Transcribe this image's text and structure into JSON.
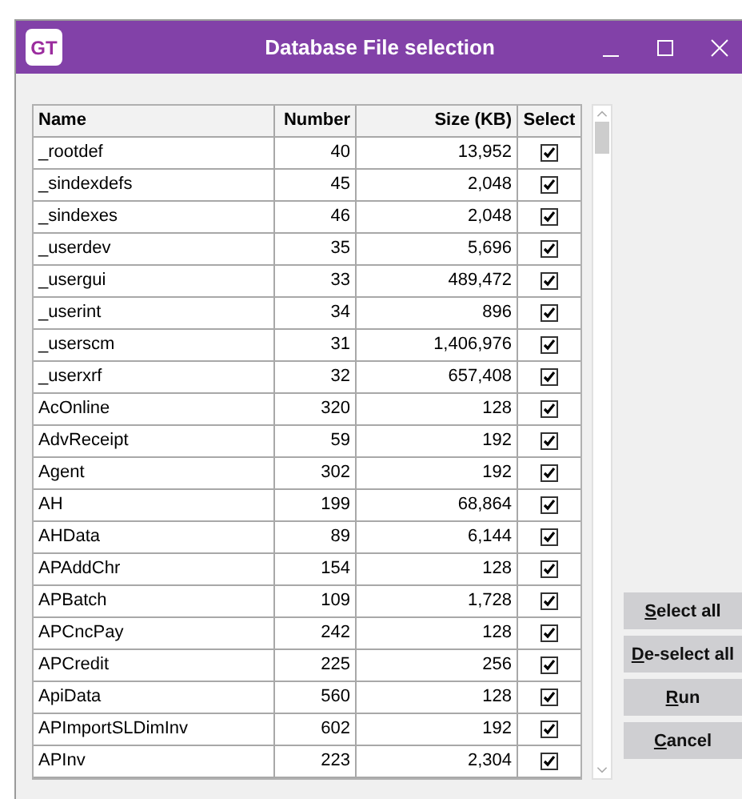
{
  "window": {
    "title": "Database File selection",
    "logo": "GT"
  },
  "table": {
    "columns": [
      "Name",
      "Number",
      "Size (KB)",
      "Select"
    ],
    "rows": [
      {
        "name": "_rootdef",
        "number": "40",
        "size": "13,952",
        "selected": true
      },
      {
        "name": "_sindexdefs",
        "number": "45",
        "size": "2,048",
        "selected": true
      },
      {
        "name": "_sindexes",
        "number": "46",
        "size": "2,048",
        "selected": true
      },
      {
        "name": "_userdev",
        "number": "35",
        "size": "5,696",
        "selected": true
      },
      {
        "name": "_usergui",
        "number": "33",
        "size": "489,472",
        "selected": true
      },
      {
        "name": "_userint",
        "number": "34",
        "size": "896",
        "selected": true
      },
      {
        "name": "_userscm",
        "number": "31",
        "size": "1,406,976",
        "selected": true
      },
      {
        "name": "_userxrf",
        "number": "32",
        "size": "657,408",
        "selected": true
      },
      {
        "name": "AcOnline",
        "number": "320",
        "size": "128",
        "selected": true
      },
      {
        "name": "AdvReceipt",
        "number": "59",
        "size": "192",
        "selected": true
      },
      {
        "name": "Agent",
        "number": "302",
        "size": "192",
        "selected": true
      },
      {
        "name": "AH",
        "number": "199",
        "size": "68,864",
        "selected": true
      },
      {
        "name": "AHData",
        "number": "89",
        "size": "6,144",
        "selected": true
      },
      {
        "name": "APAddChr",
        "number": "154",
        "size": "128",
        "selected": true
      },
      {
        "name": "APBatch",
        "number": "109",
        "size": "1,728",
        "selected": true
      },
      {
        "name": "APCncPay",
        "number": "242",
        "size": "128",
        "selected": true
      },
      {
        "name": "APCredit",
        "number": "225",
        "size": "256",
        "selected": true
      },
      {
        "name": "ApiData",
        "number": "560",
        "size": "128",
        "selected": true
      },
      {
        "name": "APImportSLDimInv",
        "number": "602",
        "size": "192",
        "selected": true
      },
      {
        "name": "APInv",
        "number": "223",
        "size": "2,304",
        "selected": true
      }
    ]
  },
  "buttons": [
    {
      "access_key": "S",
      "rest": "elect all"
    },
    {
      "access_key": "D",
      "rest": "e-select all"
    },
    {
      "access_key": "R",
      "rest": "un"
    },
    {
      "access_key": "C",
      "rest": "ancel"
    }
  ]
}
